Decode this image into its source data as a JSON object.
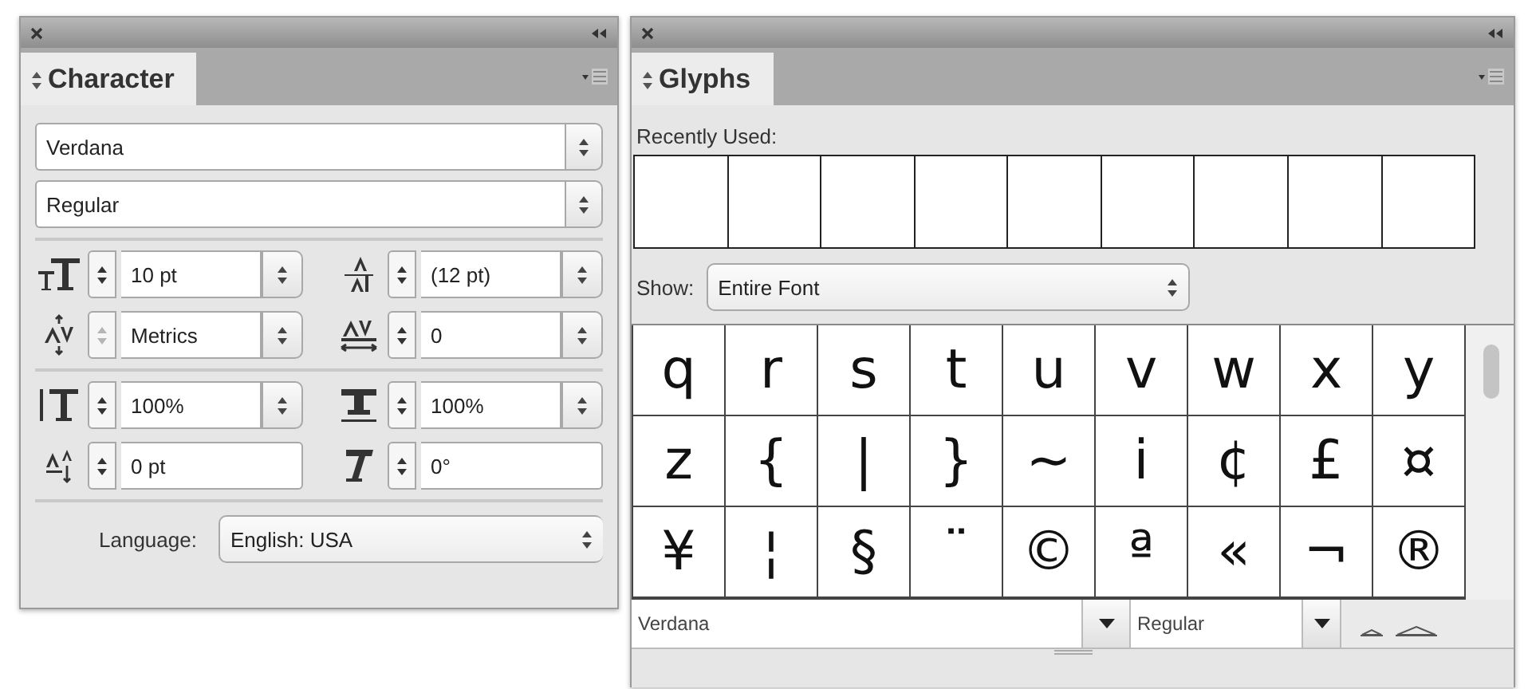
{
  "character_panel": {
    "tab": {
      "label": "Character",
      "selected": true
    },
    "font_family": "Verdana",
    "font_style": "Regular",
    "fields": [
      {
        "kind": "size",
        "value": "10 pt",
        "dropdown": true,
        "stepper_disabled": false
      },
      {
        "kind": "leading",
        "value": "(12 pt)",
        "dropdown": true,
        "stepper_disabled": false
      },
      {
        "kind": "kerning",
        "value": "Metrics",
        "dropdown": true,
        "stepper_disabled": true
      },
      {
        "kind": "tracking",
        "value": "0",
        "dropdown": true,
        "stepper_disabled": false
      },
      {
        "kind": "vscale",
        "value": "100%",
        "dropdown": true,
        "stepper_disabled": false
      },
      {
        "kind": "hscale",
        "value": "100%",
        "dropdown": true,
        "stepper_disabled": false
      },
      {
        "kind": "baseline",
        "value": "0 pt",
        "dropdown": false,
        "stepper_disabled": false
      },
      {
        "kind": "skew",
        "value": "0°",
        "dropdown": false,
        "stepper_disabled": false
      }
    ],
    "language_label": "Language:",
    "language": "English: USA"
  },
  "glyphs_panel": {
    "tab": {
      "label": "Glyphs",
      "selected": true
    },
    "recently_used_label": "Recently Used:",
    "show_label": "Show:",
    "show_value": "Entire Font",
    "glyphs": [
      "q",
      "r",
      "s",
      "t",
      "u",
      "v",
      "w",
      "x",
      "y",
      "z",
      "{",
      "|",
      "}",
      "~",
      "i",
      "¢",
      "£",
      "¤",
      "¥",
      "¦",
      "§",
      "¨",
      "©",
      "ª",
      "«",
      "¬",
      "®"
    ],
    "font_family": "Verdana",
    "font_style": "Regular"
  }
}
